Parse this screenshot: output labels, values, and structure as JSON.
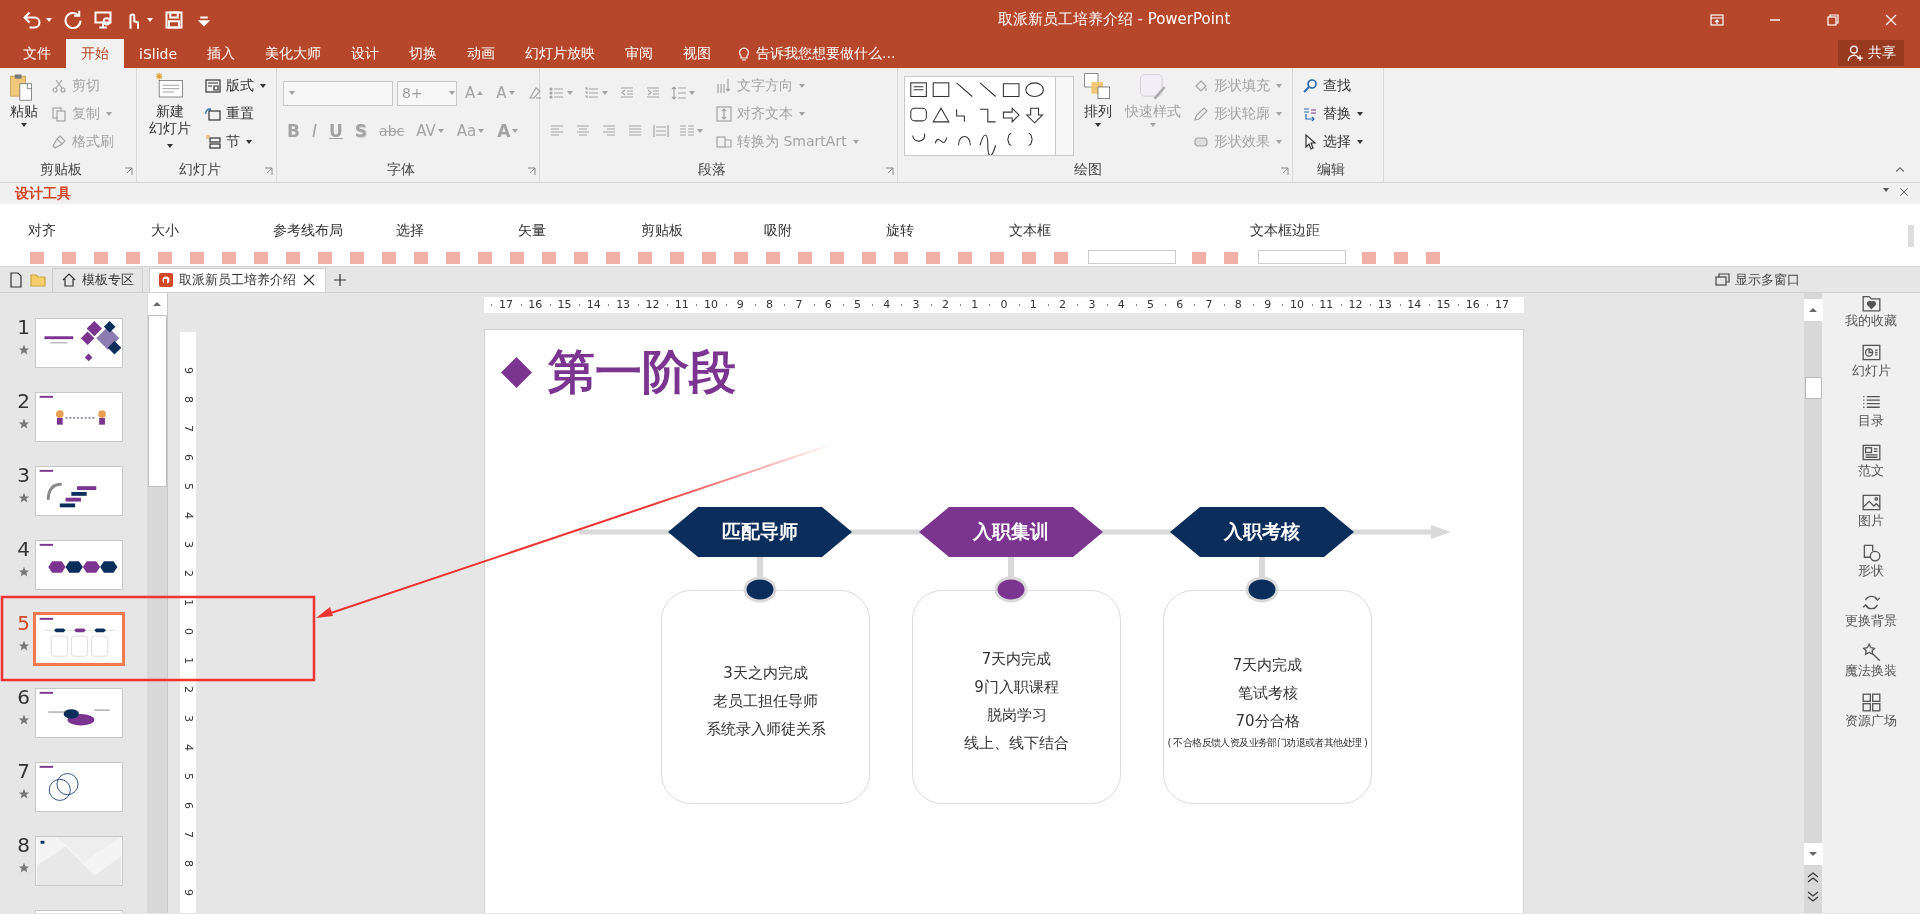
{
  "window": {
    "title": "取派新员工培养介绍 - PowerPoint"
  },
  "ribbon_tabs": [
    {
      "label": "文件",
      "selected": false
    },
    {
      "label": "开始",
      "selected": true
    },
    {
      "label": "iSlide",
      "selected": false
    },
    {
      "label": "插入",
      "selected": false
    },
    {
      "label": "美化大师",
      "selected": false
    },
    {
      "label": "设计",
      "selected": false
    },
    {
      "label": "切换",
      "selected": false
    },
    {
      "label": "动画",
      "selected": false
    },
    {
      "label": "幻灯片放映",
      "selected": false
    },
    {
      "label": "审阅",
      "selected": false
    },
    {
      "label": "视图",
      "selected": false
    }
  ],
  "tell_me": "告诉我您想要做什么...",
  "share_button": "共享",
  "ribbon_groups": [
    {
      "kind": "clipboard",
      "label": "剪贴板",
      "items": [
        {
          "label": "粘贴",
          "disabled": false,
          "dropdown": true
        },
        {
          "label": "剪切",
          "disabled": true,
          "dropdown": false
        },
        {
          "label": "复制",
          "disabled": true,
          "dropdown": true
        },
        {
          "label": "格式刷",
          "disabled": true,
          "dropdown": false
        }
      ]
    },
    {
      "kind": "slides",
      "label": "幻灯片",
      "items": [
        {
          "lines": [
            "新建",
            "幻灯片"
          ],
          "disabled": false,
          "dropdown": true
        },
        {
          "label": "版式",
          "disabled": false,
          "dropdown": true
        },
        {
          "label": "重置",
          "disabled": false,
          "dropdown": false
        },
        {
          "label": "节",
          "disabled": false,
          "dropdown": true
        }
      ]
    },
    {
      "kind": "font",
      "label": "字体",
      "disabled": true,
      "size_value": "8+",
      "buttons": [
        "A",
        "A",
        "B",
        "I",
        "U",
        "S",
        "abc",
        "AV",
        "Aa",
        "A"
      ]
    },
    {
      "kind": "paragraph",
      "label": "段落",
      "items": [
        {
          "label": "文字方向",
          "disabled": true,
          "dropdown": true
        },
        {
          "label": "对齐文本",
          "disabled": true,
          "dropdown": true
        },
        {
          "label": "转换为 SmartArt",
          "disabled": true,
          "dropdown": true
        }
      ]
    },
    {
      "kind": "drawing",
      "label": "绘图",
      "items": [
        {
          "label": "排列",
          "disabled": false,
          "dropdown": true
        },
        {
          "label": "快速样式",
          "disabled": true,
          "dropdown": true
        },
        {
          "label": "形状填充",
          "disabled": true,
          "dropdown": true
        },
        {
          "label": "形状轮廓",
          "disabled": true,
          "dropdown": true
        },
        {
          "label": "形状效果",
          "disabled": true,
          "dropdown": true
        }
      ]
    },
    {
      "kind": "editing",
      "label": "编辑",
      "items": [
        {
          "label": "查找",
          "disabled": false,
          "dropdown": false
        },
        {
          "label": "替换",
          "disabled": false,
          "dropdown": true
        },
        {
          "label": "选择",
          "disabled": false,
          "dropdown": true
        }
      ]
    }
  ],
  "design_tools": {
    "title": "设计工具",
    "sections": [
      "对齐",
      "大小",
      "参考线布局",
      "选择",
      "矢量",
      "剪贴板",
      "吸附",
      "旋转",
      "文本框",
      "文本框边距"
    ]
  },
  "doc_tabs": [
    {
      "kind": "home",
      "label": "模板专区",
      "selected": false
    },
    {
      "kind": "document",
      "label": "取派新员工培养介绍",
      "selected": true
    }
  ],
  "multi_window": "显示多窗口",
  "slides": [
    {
      "number": "1",
      "selected": false
    },
    {
      "number": "2",
      "selected": false
    },
    {
      "number": "3",
      "selected": false
    },
    {
      "number": "4",
      "selected": false
    },
    {
      "number": "5",
      "selected": true
    },
    {
      "number": "6",
      "selected": false
    },
    {
      "number": "7",
      "selected": false
    },
    {
      "number": "8",
      "selected": false
    },
    {
      "selected": false
    }
  ],
  "ruler_horizontal": [
    "17",
    "16",
    "15",
    "14",
    "13",
    "12",
    "11",
    "10",
    "9",
    "8",
    "7",
    "6",
    "5",
    "4",
    "3",
    "2",
    "1",
    "0",
    "1",
    "2",
    "3",
    "4",
    "5",
    "6",
    "7",
    "8",
    "9",
    "10",
    "11",
    "12",
    "13",
    "14",
    "15",
    "16",
    "17"
  ],
  "ruler_vertical": [
    "9",
    "8",
    "7",
    "6",
    "5",
    "4",
    "3",
    "2",
    "1",
    "0",
    "1",
    "2",
    "3",
    "4",
    "5",
    "6",
    "7",
    "8",
    "9"
  ],
  "slide": {
    "title": "第一阶段",
    "steps": [
      {
        "heading": "匹配导师",
        "color": "#0b2d5c",
        "lines": [
          "3天之内完成",
          "老员工担任导师",
          "系统录入师徒关系"
        ]
      },
      {
        "heading": "入职集训",
        "color": "#7b3590",
        "lines": [
          "7天内完成",
          "9门入职课程",
          "脱岗学习",
          "线上、线下结合"
        ]
      },
      {
        "heading": "入职考核",
        "color": "#0b2d5c",
        "lines": [
          "7天内完成",
          "笔试考核",
          "70分合格"
        ],
        "note": "( 不合格反馈人资及业务部门劝退或者其他处理 )"
      }
    ]
  },
  "side_panel": [
    "我的收藏",
    "幻灯片",
    "目录",
    "范文",
    "图片",
    "形状",
    "更换背景",
    "魔法换装",
    "资源广场"
  ]
}
